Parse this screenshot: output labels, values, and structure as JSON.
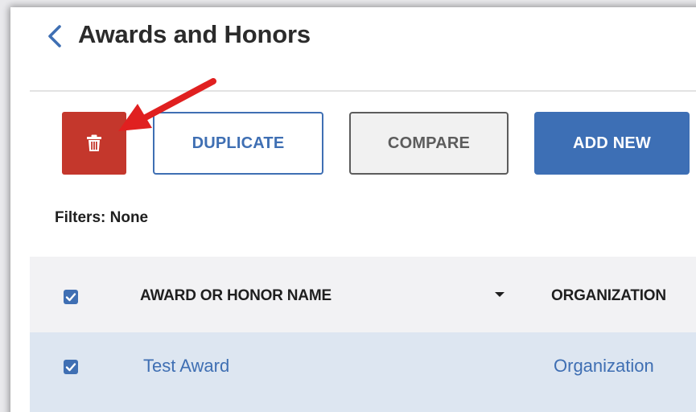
{
  "header": {
    "title": "Awards and Honors",
    "back_icon": "chevron-left-icon"
  },
  "toolbar": {
    "delete_icon": "trash-icon",
    "duplicate_label": "DUPLICATE",
    "compare_label": "COMPARE",
    "add_new_label": "ADD NEW"
  },
  "filters": {
    "label": "Filters: None"
  },
  "table": {
    "columns": [
      {
        "label": "AWARD OR HONOR NAME",
        "sort_icon": "caret-down-icon"
      },
      {
        "label": "ORGANIZATION"
      }
    ],
    "rows": [
      {
        "checked": true,
        "cells": [
          "Test Award",
          "Organization"
        ]
      }
    ]
  },
  "colors": {
    "accent": "#3F6FB3",
    "danger": "#C4372C",
    "annotation": "#E02020",
    "header_bg": "#F2F2F4",
    "selected_row_bg": "#DDE6F1"
  }
}
